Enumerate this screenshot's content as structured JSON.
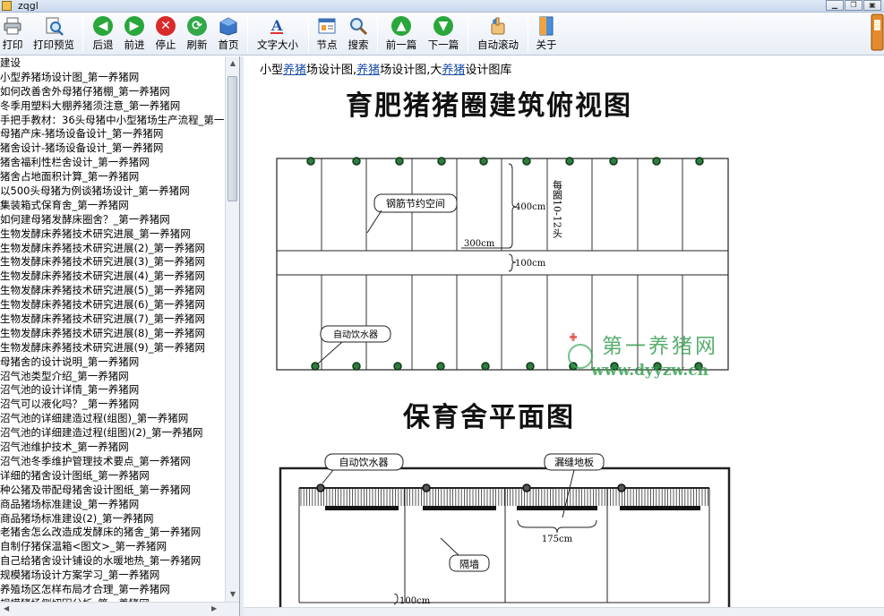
{
  "window": {
    "title": "zqgl"
  },
  "toolbar": {
    "print": "打印",
    "print_preview": "打印预览",
    "back": "后退",
    "forward": "前进",
    "stop": "停止",
    "refresh": "刷新",
    "home": "首页",
    "font_size": "文字大小",
    "sections": "节点",
    "search": "搜索",
    "prev": "前一篇",
    "next": "下一篇",
    "autoscroll": "自动滚动",
    "about": "关于"
  },
  "sidebar": {
    "items": [
      "建设",
      "小型养猪场设计图_第一养猪网",
      "如何改善舍外母猪仔猪棚_第一养猪网",
      "冬季用塑料大棚养猪须注意_第一养猪网",
      "手把手教材：36头母猪中小型猪场生产流程_第一",
      "母猪产床-猪场设备设计_第一养猪网",
      "猪舍设计-猪场设备设计_第一养猪网",
      "猪舍福利性栏舍设计_第一养猪网",
      "猪舍占地面积计算_第一养猪网",
      "以500头母猪为例谈猪场设计_第一养猪网",
      "集装箱式保育舍_第一养猪网",
      "如何建母猪发酵床圈舍？_第一养猪网",
      "生物发酵床养猪技术研究进展_第一养猪网",
      "生物发酵床养猪技术研究进展(2)_第一养猪网",
      "生物发酵床养猪技术研究进展(3)_第一养猪网",
      "生物发酵床养猪技术研究进展(4)_第一养猪网",
      "生物发酵床养猪技术研究进展(5)_第一养猪网",
      "生物发酵床养猪技术研究进展(6)_第一养猪网",
      "生物发酵床养猪技术研究进展(7)_第一养猪网",
      "生物发酵床养猪技术研究进展(8)_第一养猪网",
      "生物发酵床养猪技术研究进展(9)_第一养猪网",
      "母猪舍的设计说明_第一养猪网",
      "沼气池类型介绍_第一养猪网",
      "沼气池的设计详情_第一养猪网",
      "沼气可以液化吗？_第一养猪网",
      "沼气池的详细建造过程(组图)_第一养猪网",
      "沼气池的详细建造过程(组图)(2)_第一养猪网",
      "沼气池维护技术_第一养猪网",
      "沼气池冬季维护管理技术要点_第一养猪网",
      "详细的猪舍设计图纸_第一养猪网",
      "种公猪及带配母猪舍设计图纸_第一养猪网",
      "商品猪场标准建设_第一养猪网",
      "商品猪场标准建设(2)_第一养猪网",
      "老猪舍怎么改造成发酵床的猪舍_第一养猪网",
      "自制仔猪保温箱<图文>_第一养猪网",
      "自己给猪舍设计铺设的水暖地热_第一养猪网",
      "规模猪场设计方案学习_第一养猪网",
      "养殖场区怎样布局才合理_第一养猪网",
      "规模猪场侧切因分析_第一养猪网"
    ]
  },
  "content": {
    "caption_parts": [
      "小型",
      "养猪",
      "场设计图,",
      "养猪",
      "场设计图,大",
      "养猪",
      "设计图库"
    ],
    "title1": "育肥猪猪圈建筑俯视图",
    "title2": "保育舍平面图",
    "labels": {
      "rebar": "钢筋节约空间",
      "dim400": "400cm",
      "dim300": "300cm",
      "dim100a": "100cm",
      "per_pen": "每圈10-12头",
      "drinker1": "自动饮水器",
      "drinker2": "自动饮水器",
      "slatted": "漏缝地板",
      "wall": "隔墙",
      "dim175": "175cm",
      "dim100b": "100cm"
    },
    "watermark": {
      "name": "第一养猪网",
      "url": "www.dyyzw.cn"
    }
  }
}
